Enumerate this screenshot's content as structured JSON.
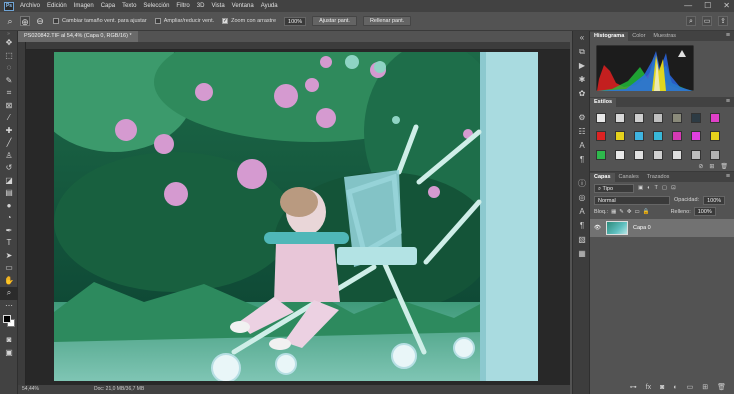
{
  "app": {
    "logo": "Ps"
  },
  "menubar": {
    "items": [
      "Archivo",
      "Edición",
      "Imagen",
      "Capa",
      "Texto",
      "Selección",
      "Filtro",
      "3D",
      "Vista",
      "Ventana",
      "Ayuda"
    ]
  },
  "window_controls": {
    "minimize": "—",
    "maximize": "☐",
    "close": "✕"
  },
  "options": {
    "resize_windows": "Cambiar tamaño vent. para ajustar",
    "zoom_all": "Ampliar/reducir vent.",
    "scrubby_zoom": "Zoom con arrastre",
    "scrubby_zoom_checked": true,
    "zoom_value": "100%",
    "fit_screen": "Ajustar pant.",
    "fill_screen": "Rellenar pant."
  },
  "document": {
    "tab_title": "PS020842.TIF al 54,4% (Capa 0, RGB/16) *",
    "close": "×"
  },
  "status": {
    "zoom": "54,44%",
    "doc_info": "Doc: 21,0 MB/36,7 MB"
  },
  "panels": {
    "histogram_tabs": [
      "Histograma",
      "Color",
      "Muestras"
    ],
    "styles_tab": "Estilos",
    "layers_tabs": [
      "Capas",
      "Canales",
      "Trazados"
    ],
    "filter_kind": "Tipo",
    "blend_mode": "Normal",
    "opacity_label": "Opacidad:",
    "opacity_value": "100%",
    "lock_label": "Bloq.:",
    "fill_label": "Relleno:",
    "fill_value": "100%",
    "layer_name": "Capa 0",
    "menu_icon": "≡"
  },
  "styles_swatches": [
    "#e8e8e8",
    "#d9d9d9",
    "#cfcfcf",
    "#bfbfbf",
    "#8a8a7a",
    "#2d3b44",
    "#e040c8",
    "#dd2222",
    "#e6d21c",
    "#3fb4e0",
    "#38b8d8",
    "#d63ab4",
    "#e040e0",
    "#e6d21c",
    "#2eb84c",
    "#e8e8e8",
    "#e0e0e0",
    "#cfcfcf",
    "#dddddd",
    "#bdbdbd",
    "#b0b0b0"
  ]
}
